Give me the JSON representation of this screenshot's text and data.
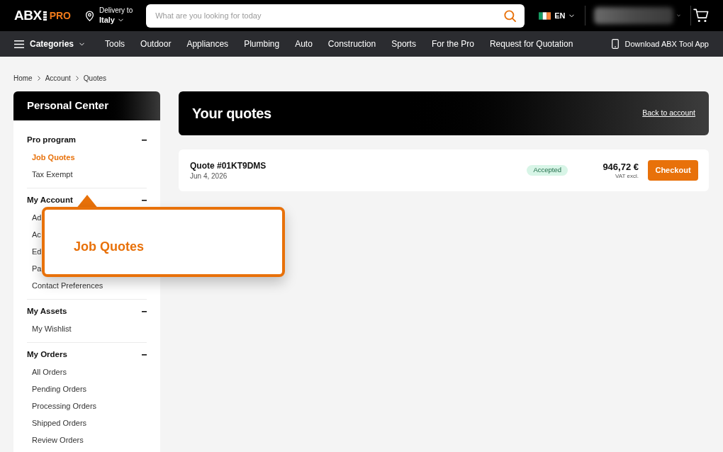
{
  "header": {
    "logo": {
      "wordmark": "ABX",
      "tier": "PRO"
    },
    "delivery": {
      "label": "Delivery to",
      "country": "Italy"
    },
    "search": {
      "placeholder": "What are you looking for today"
    },
    "language": {
      "code": "EN"
    }
  },
  "nav": {
    "categories": "Categories",
    "links": [
      "Tools",
      "Outdoor",
      "Appliances",
      "Plumbing",
      "Auto",
      "Construction",
      "Sports",
      "For the Pro",
      "Request for Quotation"
    ],
    "app_link": "Download ABX Tool App"
  },
  "breadcrumb": [
    "Home",
    "Account",
    "Quotes"
  ],
  "sidebar": {
    "title": "Personal Center",
    "sections": [
      {
        "title": "Pro program",
        "expanded": true,
        "items": [
          {
            "label": "Job Quotes",
            "selected": true
          },
          {
            "label": "Tax Exempt",
            "selected": false
          }
        ]
      },
      {
        "title": "My Account",
        "expanded": true,
        "items": [
          {
            "label": "Ad",
            "selected": false
          },
          {
            "label": "Ac",
            "selected": false
          },
          {
            "label": "Ed",
            "selected": false
          },
          {
            "label": "Pa",
            "selected": false
          },
          {
            "label": "Contact Preferences",
            "selected": false
          }
        ]
      },
      {
        "title": "My Assets",
        "expanded": true,
        "items": [
          {
            "label": "My Wishlist",
            "selected": false
          }
        ]
      },
      {
        "title": "My Orders",
        "expanded": true,
        "items": [
          {
            "label": "All Orders",
            "selected": false
          },
          {
            "label": "Pending Orders",
            "selected": false
          },
          {
            "label": "Processing Orders",
            "selected": false
          },
          {
            "label": "Shipped Orders",
            "selected": false
          },
          {
            "label": "Review Orders",
            "selected": false
          }
        ]
      }
    ]
  },
  "page_header": {
    "title": "Your quotes",
    "back_link": "Back to account"
  },
  "quotes": [
    {
      "number": "Quote #01KT9DMS",
      "date": "Jun 4, 2026",
      "status": "Accepted",
      "price": "946,72 €",
      "tax_note": "VAT excl.",
      "action": "Checkout"
    }
  ],
  "callout": {
    "text": "Job Quotes"
  }
}
